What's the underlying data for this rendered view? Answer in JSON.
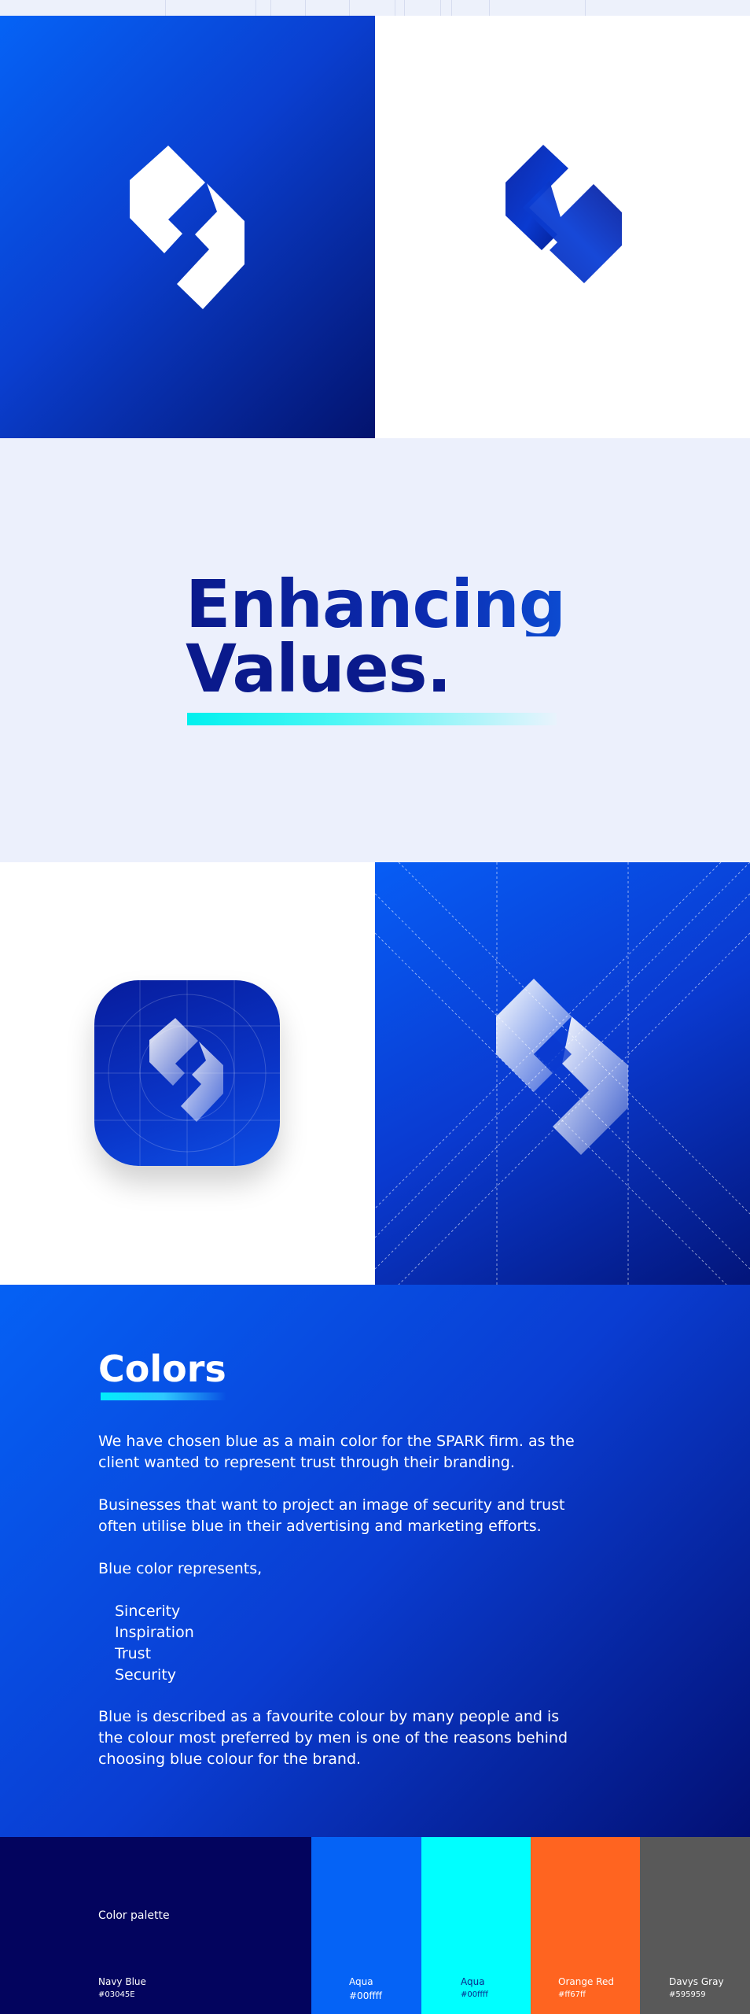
{
  "tagline": {
    "line1": "Enhancing",
    "line2": "Values."
  },
  "colors_section": {
    "title": "Colors",
    "paragraph1": "We have chosen blue as a main color for the SPARK firm. as the client wanted to represent trust through their branding.",
    "paragraph2": "Businesses that want to project an image of security and trust often utilise blue in their advertising and marketing efforts.",
    "paragraph3": "Blue color represents,",
    "represents": [
      "Sincerity",
      "Inspiration",
      "Trust",
      "Security"
    ],
    "paragraph4": "Blue is described as a favourite colour by many people and is the colour most preferred by men is one of the reasons behind choosing blue colour for the brand."
  },
  "palette": {
    "label": "Color palette",
    "swatches": [
      {
        "name": "Navy Blue",
        "hex_label": "#03045E",
        "color": "#03045e"
      },
      {
        "name": "Aqua",
        "hex_label": "#00ffff",
        "color": "#0563f6"
      },
      {
        "name": "Aqua",
        "hex_label": "#00ffff",
        "color": "#00ffff"
      },
      {
        "name": "Orange Red",
        "hex_label": "#ff67ff",
        "color": "#ff6420"
      },
      {
        "name": "Davys Gray",
        "hex_label": "#595959",
        "color": "#595959"
      }
    ]
  },
  "icons": {
    "logo": "spark-s-logo-icon"
  }
}
